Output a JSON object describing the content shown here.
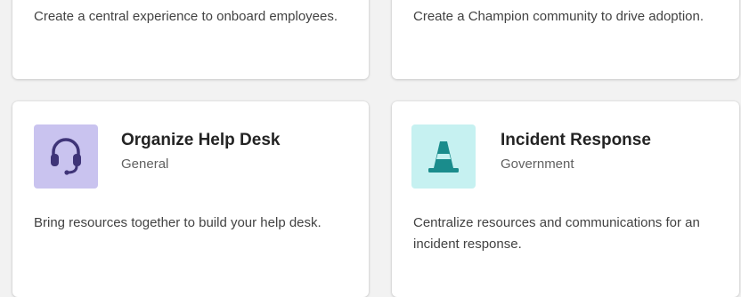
{
  "cards": [
    {
      "description": "Create a central experience to onboard employees."
    },
    {
      "description": "Create a Champion community to drive adoption."
    },
    {
      "title": "Organize Help Desk",
      "category": "General",
      "description": "Bring resources together to build your help desk.",
      "icon": "headset-icon",
      "icon_bg": "#c9c3ef",
      "icon_color": "#3f3478"
    },
    {
      "title": "Incident Response",
      "category": "Government",
      "description": "Centralize resources and communications for an incident response.",
      "icon": "traffic-cone-icon",
      "icon_bg": "#c6f1f1",
      "icon_color": "#1a8c8c"
    }
  ]
}
